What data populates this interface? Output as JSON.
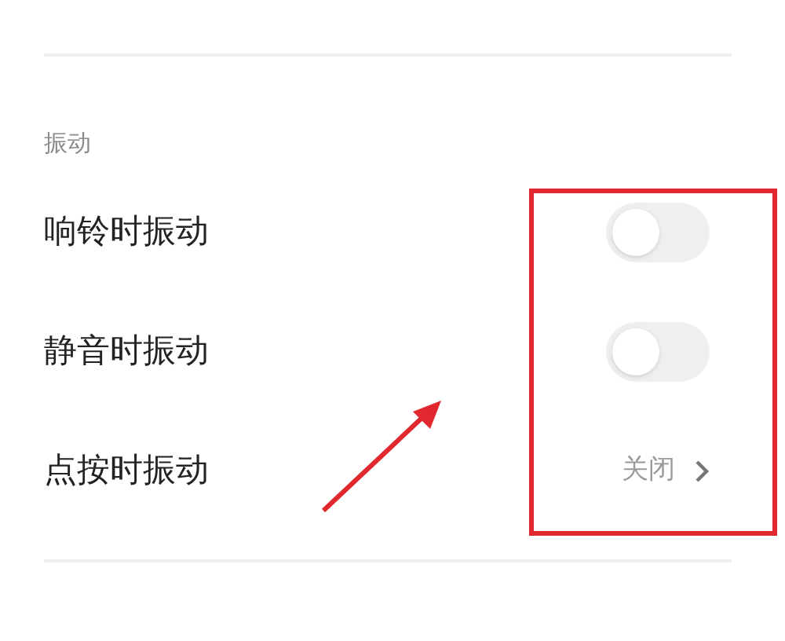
{
  "section": {
    "title": "振动"
  },
  "rows": [
    {
      "label": "响铃时振动",
      "kind": "toggle",
      "on": false
    },
    {
      "label": "静音时振动",
      "kind": "toggle",
      "on": false
    },
    {
      "label": "点按时振动",
      "kind": "value",
      "value": "关闭"
    }
  ]
}
